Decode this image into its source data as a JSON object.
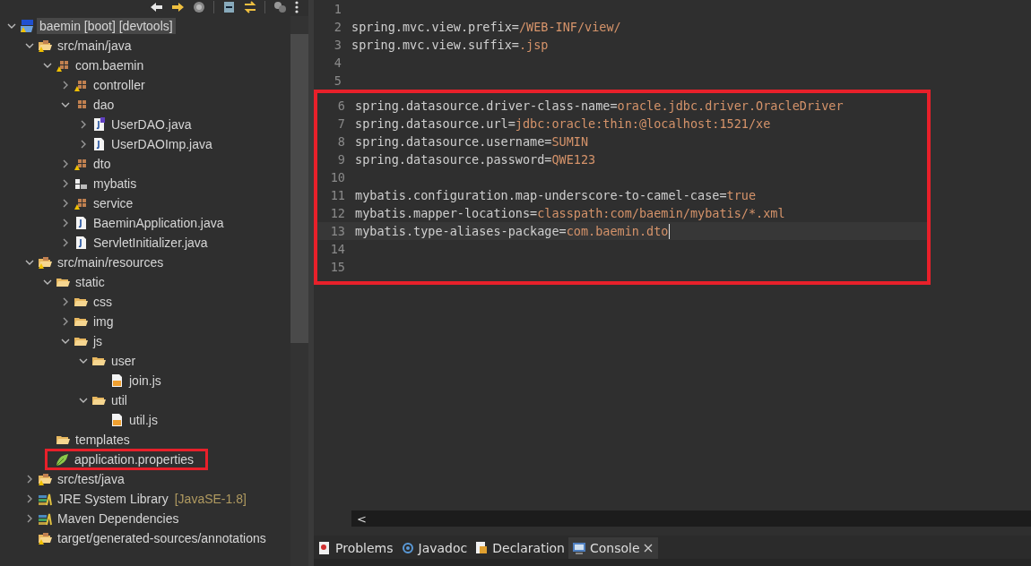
{
  "explorer": {
    "tree": [
      {
        "label": "baemin [boot] [devtools]",
        "kind": "project",
        "expanded": true,
        "selected": true,
        "children": [
          {
            "label": "src/main/java",
            "kind": "srcfolder",
            "expanded": true,
            "children": [
              {
                "label": "com.baemin",
                "kind": "package",
                "expanded": true,
                "children": [
                  {
                    "label": "controller",
                    "kind": "package",
                    "expanded": false
                  },
                  {
                    "label": "dao",
                    "kind": "package-plain",
                    "expanded": true,
                    "children": [
                      {
                        "label": "UserDAO.java",
                        "kind": "interface",
                        "expanded": false
                      },
                      {
                        "label": "UserDAOImp.java",
                        "kind": "java",
                        "expanded": false
                      }
                    ]
                  },
                  {
                    "label": "dto",
                    "kind": "package",
                    "expanded": false
                  },
                  {
                    "label": "mybatis",
                    "kind": "package-empty",
                    "expanded": false
                  },
                  {
                    "label": "service",
                    "kind": "package",
                    "expanded": false
                  },
                  {
                    "label": "BaeminApplication.java",
                    "kind": "java",
                    "expanded": false
                  },
                  {
                    "label": "ServletInitializer.java",
                    "kind": "java",
                    "expanded": false
                  }
                ]
              }
            ]
          },
          {
            "label": "src/main/resources",
            "kind": "srcfolder",
            "expanded": true,
            "children": [
              {
                "label": "static",
                "kind": "folder",
                "expanded": true,
                "children": [
                  {
                    "label": "css",
                    "kind": "folder",
                    "expanded": false
                  },
                  {
                    "label": "img",
                    "kind": "folder",
                    "expanded": false
                  },
                  {
                    "label": "js",
                    "kind": "folder",
                    "expanded": true,
                    "children": [
                      {
                        "label": "user",
                        "kind": "folder",
                        "expanded": true,
                        "children": [
                          {
                            "label": "join.js",
                            "kind": "js"
                          }
                        ]
                      },
                      {
                        "label": "util",
                        "kind": "folder",
                        "expanded": true,
                        "children": [
                          {
                            "label": "util.js",
                            "kind": "js"
                          }
                        ]
                      }
                    ]
                  }
                ]
              },
              {
                "label": "templates",
                "kind": "folder"
              },
              {
                "label": "application.properties",
                "kind": "spring",
                "highlighted": true
              }
            ]
          },
          {
            "label": "src/test/java",
            "kind": "srcfolder",
            "expanded": false
          },
          {
            "label": "JRE System Library",
            "decoration": "[JavaSE-1.8]",
            "kind": "library",
            "expanded": false
          },
          {
            "label": "Maven Dependencies",
            "kind": "library",
            "expanded": false
          },
          {
            "label": "target/generated-sources/annotations",
            "kind": "srcfolder"
          }
        ]
      }
    ]
  },
  "editor": {
    "sections": [
      {
        "boxed": false,
        "lines": [
          {
            "number": "1"
          },
          {
            "number": "2",
            "key": "spring.mvc.view.prefix=",
            "value": "/WEB-INF/view/"
          },
          {
            "number": "3",
            "key": "spring.mvc.view.suffix=",
            "value": ".jsp"
          },
          {
            "number": "4"
          },
          {
            "number": "5"
          }
        ]
      },
      {
        "boxed": true,
        "lines": [
          {
            "number": "6",
            "key": "spring.datasource.driver-class-name=",
            "value": "oracle.jdbc.driver.OracleDriver"
          },
          {
            "number": "7",
            "key": "spring.datasource.url=",
            "value": "jdbc:oracle:thin:@localhost:1521/xe"
          },
          {
            "number": "8",
            "key": "spring.datasource.username=",
            "value": "SUMIN"
          },
          {
            "number": "9",
            "key": "spring.datasource.password=",
            "value": "QWE123"
          },
          {
            "number": "10"
          },
          {
            "number": "11",
            "key": "mybatis.configuration.map-underscore-to-camel-case=",
            "value": "true"
          },
          {
            "number": "12",
            "key": "mybatis.mapper-locations=",
            "value": "classpath:com/baemin/mybatis/*.xml"
          },
          {
            "number": "13",
            "key": "mybatis.type-aliases-package=",
            "value": "com.baemin.dto",
            "current": true
          },
          {
            "number": "14"
          },
          {
            "number": "15"
          }
        ]
      }
    ]
  },
  "scroll_left": "<",
  "bottom_tabs": [
    {
      "label": "Problems",
      "kind": "problems",
      "selected": false
    },
    {
      "label": "Javadoc",
      "kind": "javadoc",
      "selected": false
    },
    {
      "label": "Declaration",
      "kind": "declaration",
      "selected": false
    },
    {
      "label": "Console",
      "kind": "console",
      "selected": true
    }
  ]
}
